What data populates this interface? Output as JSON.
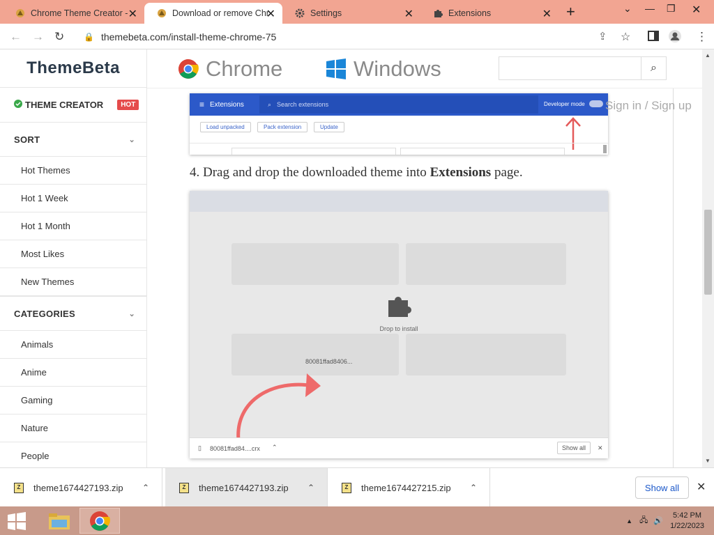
{
  "browser": {
    "tabs": [
      {
        "title": "Chrome Theme Creator -",
        "active": false
      },
      {
        "title": "Download or remove Chr",
        "active": true
      },
      {
        "title": "Settings",
        "active": false
      },
      {
        "title": "Extensions",
        "active": false
      }
    ],
    "url": "themebeta.com/install-theme-chrome-75"
  },
  "site": {
    "brand": "ThemeBeta",
    "nav": [
      "Chrome",
      "Windows"
    ],
    "sign_in": "Sign in / Sign up",
    "sidebar": {
      "theme_creator": "THEME CREATOR",
      "hot_badge": "HOT",
      "sort_header": "SORT",
      "sort_items": [
        "Hot Themes",
        "Hot 1 Week",
        "Hot 1 Month",
        "Most Likes",
        "New Themes"
      ],
      "categories_header": "CATEGORIES",
      "category_items": [
        "Animals",
        "Anime",
        "Gaming",
        "Nature",
        "People"
      ]
    }
  },
  "article": {
    "ext_screenshot": {
      "title": "Extensions",
      "search_placeholder": "Search extensions",
      "developer_mode": "Developer mode",
      "buttons": [
        "Load unpacked",
        "Pack extension",
        "Update"
      ]
    },
    "step_prefix": "4. Drag and drop the downloaded theme into ",
    "step_bold": "Extensions",
    "step_suffix": " page.",
    "drop_screenshot": {
      "drop_label": "Drop to install",
      "drag_file": "80081ffad8406...",
      "dl_file": "80081ffad84....crx",
      "show_all": "Show all"
    }
  },
  "downloads": {
    "items": [
      {
        "name": "theme1674427193.zip",
        "selected": false
      },
      {
        "name": "theme1674427193.zip",
        "selected": true
      },
      {
        "name": "theme1674427215.zip",
        "selected": false
      }
    ],
    "show_all": "Show all"
  },
  "taskbar": {
    "time": "5:42 PM",
    "date": "1/22/2023"
  }
}
